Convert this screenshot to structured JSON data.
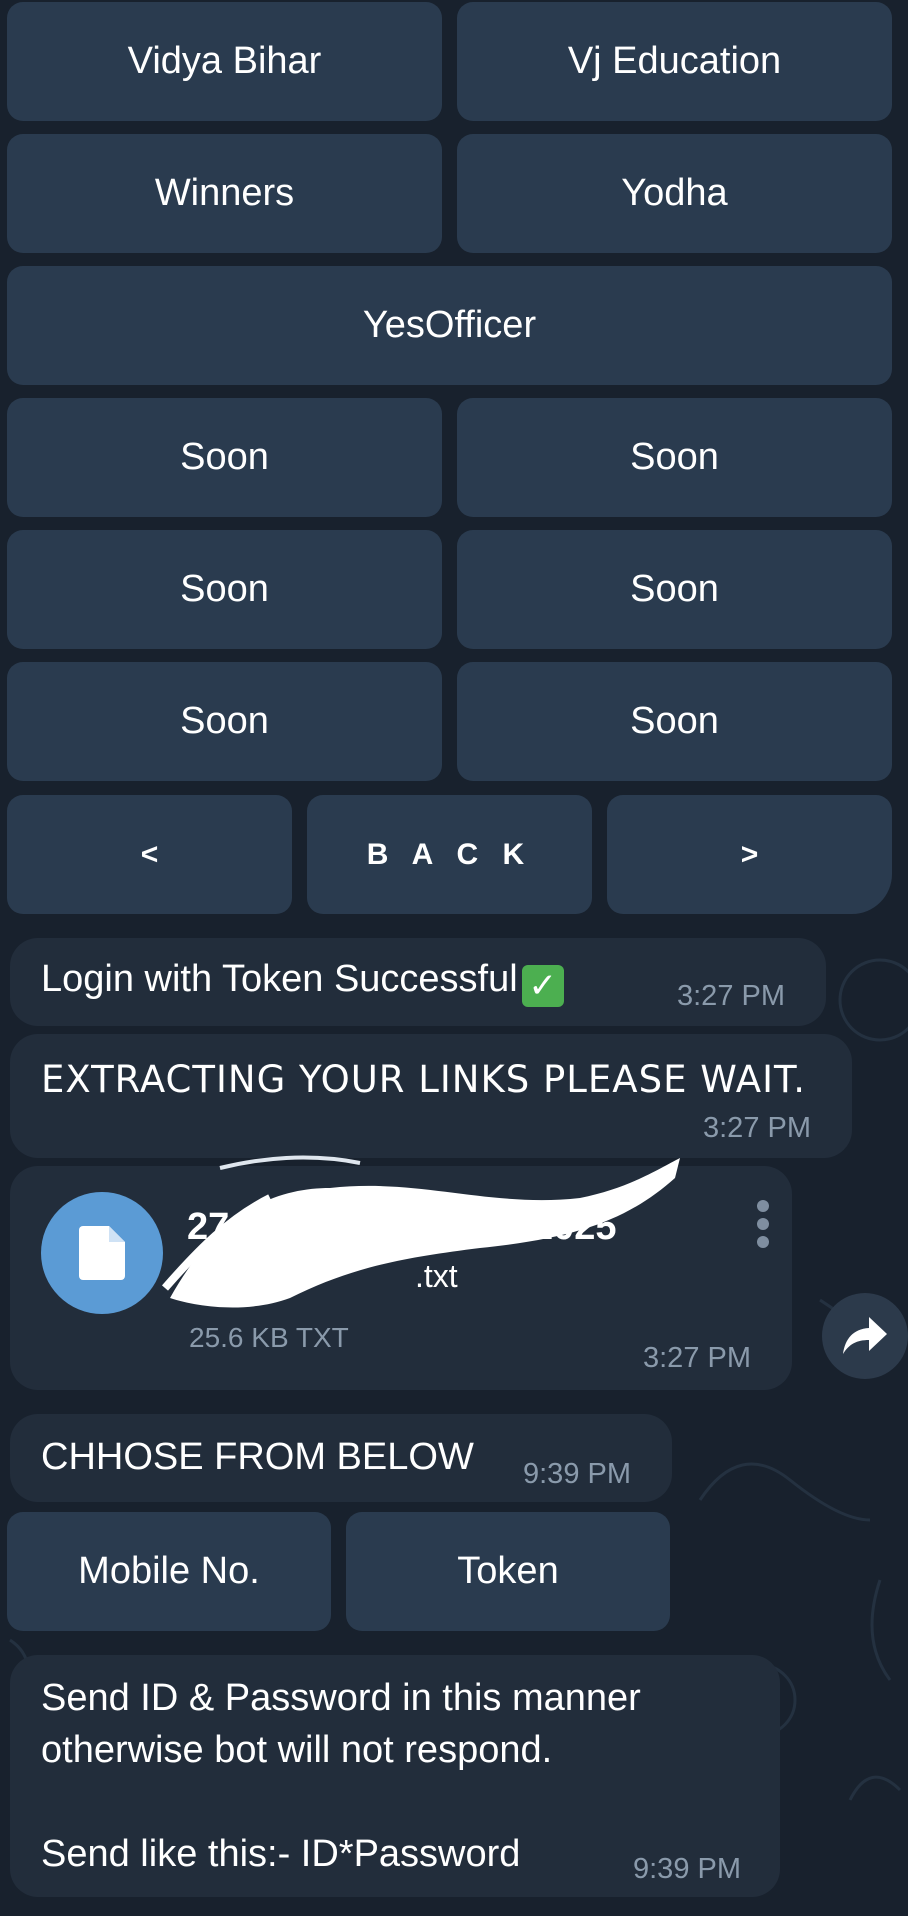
{
  "keyboard_main": {
    "rows": [
      [
        "Vidya Bihar",
        "Vj Education"
      ],
      [
        "Winners",
        "Yodha"
      ],
      [
        "YesOfficer"
      ],
      [
        "Soon",
        "Soon"
      ],
      [
        "Soon",
        "Soon"
      ],
      [
        "Soon",
        "Soon"
      ]
    ],
    "nav": {
      "prev": "<",
      "back": "B A C K",
      "next": ">"
    }
  },
  "messages": {
    "login": {
      "text": "Login with Token Successful",
      "emoji": "check-mark-button-icon",
      "time": "3:27 PM"
    },
    "extracting": {
      "text": "EXTRACTING YOUR LINKS PLEASE WAIT.",
      "time": "3:27 PM"
    },
    "file": {
      "name_line1": "27",
      "name_line1_tail": "2025",
      "name_line2_tail": ".txt",
      "meta": "25.6 KB TXT",
      "time": "3:27 PM",
      "icon": "document-icon",
      "menu_icon": "more-vertical-icon",
      "share_icon": "forward-share-icon"
    },
    "choose": {
      "text": "CHHOSE FROM BELOW",
      "time": "9:39 PM"
    },
    "send_info": {
      "line1": "Send ID & Password in this manner",
      "line2": "otherwise bot will not respond.",
      "line3": "Send like this:-  ID*Password",
      "time": "9:39 PM"
    }
  },
  "keyboard_login": {
    "mobile": "Mobile No.",
    "token": "Token"
  },
  "colors": {
    "background": "#18212d",
    "button": "#2a3b4f",
    "bubble": "#222d3b",
    "file_icon_bg": "#5b9bd5",
    "time": "#8a9aab"
  }
}
